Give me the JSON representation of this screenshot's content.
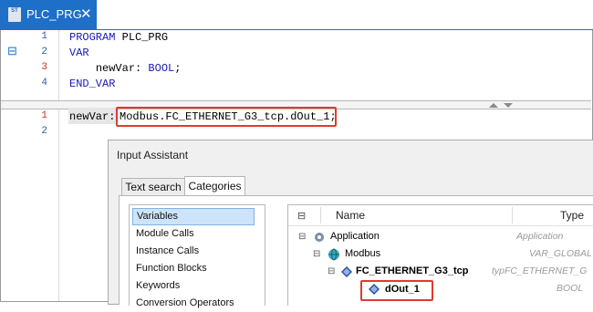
{
  "tab": {
    "icon_text": "ST",
    "label": "PLC_PRG",
    "close": "✕"
  },
  "declaration": {
    "lines": [
      {
        "num": "1",
        "kw": "PROGRAM",
        "rest": " PLC_PRG",
        "indent": ""
      },
      {
        "num": "2",
        "kw": "VAR",
        "rest": "",
        "indent": ""
      },
      {
        "num": "3",
        "kw": "",
        "rest": "newVar: ",
        "kw2": "BOOL",
        "tail": ";",
        "indent": "    "
      },
      {
        "num": "4",
        "kw": "END_VAR",
        "rest": "",
        "indent": ""
      }
    ],
    "fold_marker": "⊟"
  },
  "implementation": {
    "line1_num": "1",
    "line2_num": "2",
    "var_name": "newVar:",
    "expression": "Modbus.FC_ETHERNET_G3_tcp.dOut_1;"
  },
  "input_assistant": {
    "title": "Input Assistant",
    "tabs": [
      "Text search",
      "Categories"
    ],
    "categories": [
      "Variables",
      "Module Calls",
      "Instance Calls",
      "Function Blocks",
      "Keywords",
      "Conversion Operators"
    ],
    "selected_category": "Variables",
    "columns": {
      "name": "Name",
      "type": "Type"
    },
    "tree": [
      {
        "name": "Application",
        "type": "Application"
      },
      {
        "name": "Modbus",
        "type": "VAR_GLOBAL"
      },
      {
        "name": "FC_ETHERNET_G3_tcp",
        "type": "typFC_ETHERNET_G"
      },
      {
        "name": "dOut_1",
        "type": "BOOL"
      }
    ]
  },
  "colors": {
    "accent": "#1e6fc8",
    "highlight": "#e03a2f",
    "keyword": "#1a1ab5",
    "line_number": "#2a5fa8",
    "line_number_changed": "#d0301e"
  }
}
